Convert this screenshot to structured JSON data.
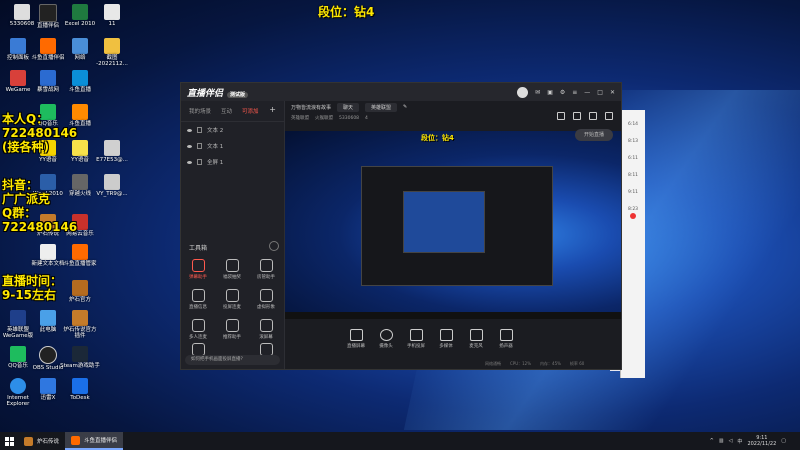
{
  "overlay": {
    "rank_label": "段位：钻4",
    "promo_qq": "本人Q：\n722480146\n(接各种)",
    "promo_douyin": "抖音：\n广广派克\nQ群：\n722480146",
    "promo_time": "直播时间：\n9-15左右"
  },
  "desktop_icons": [
    {
      "name": "user-id",
      "label": "5330608"
    },
    {
      "name": "live-companion",
      "label": "直播伴侣"
    },
    {
      "name": "excel",
      "label": "Excel 2010"
    },
    {
      "name": "folder-11",
      "label": "11"
    },
    {
      "name": "control-panel",
      "label": "控制面板"
    },
    {
      "name": "douyu-live",
      "label": "斗鱼直播伴侣"
    },
    {
      "name": "network",
      "label": "网络"
    },
    {
      "name": "date-folder",
      "label": "截图\n-2022112..."
    },
    {
      "name": "wegame",
      "label": "WeGame"
    },
    {
      "name": "baidu-netdisk",
      "label": "暴雪战网"
    },
    {
      "name": "douyu-app",
      "label": "斗鱼直播"
    },
    {
      "name": "qq-music",
      "label": "QQ音乐"
    },
    {
      "name": "yy-voice",
      "label": "YY语音"
    },
    {
      "name": "zip-file",
      "label": "E77E53@..."
    },
    {
      "name": "word",
      "label": "Word 2010"
    },
    {
      "name": "game-client",
      "label": "穿越火线"
    },
    {
      "name": "vm-file",
      "label": "VY_TR9@..."
    },
    {
      "name": "hearthstone",
      "label": "炉石传说"
    },
    {
      "name": "douyu-helper",
      "label": "斗鱼直播管家"
    },
    {
      "name": "netease-music",
      "label": "网易云音乐"
    },
    {
      "name": "new-txt",
      "label": "新建文本文档"
    },
    {
      "name": "game-box",
      "label": "炉石官方"
    },
    {
      "name": "hs-deck",
      "label": "暗影宇宙"
    },
    {
      "name": "wegame-2",
      "label": "英雄联盟\nWeGame版"
    },
    {
      "name": "this-pc",
      "label": "此电脑"
    },
    {
      "name": "hs-official",
      "label": "炉石传说官方\n插件"
    },
    {
      "name": "qq-music-2",
      "label": "QQ音乐"
    },
    {
      "name": "obs",
      "label": "OBS Studio"
    },
    {
      "name": "steam",
      "label": "Steam游戏助手"
    },
    {
      "name": "ie",
      "label": "Internet\nExplorer"
    },
    {
      "name": "xunlei",
      "label": "迅雷X"
    },
    {
      "name": "todesk",
      "label": "ToDesk"
    }
  ],
  "app": {
    "logo": "直播伴侣",
    "version": "测试版",
    "tabs": [
      "我的场景",
      "互动",
      "可添加"
    ],
    "scenes": [
      "文本 2",
      "文本 1",
      "全屏 1"
    ],
    "toolbox_title": "工具箱",
    "tools": [
      "弹幕助手",
      "福袋抽奖",
      "房管助手",
      "直播信息",
      "投屏连麦",
      "虚拟形象",
      "多人连麦",
      "推荐助手",
      "滚屏幕",
      "抖音宝",
      "",
      "更多"
    ],
    "hint": "如何把手机画面投屏直播?",
    "stream_title": "万物皆流浪有故事",
    "stream_chip_1": "聊天",
    "stream_chip_2": "英雄联盟",
    "stream_category": "英雄联盟",
    "stream_sub": "火猴联盟",
    "stream_rank": "5330608",
    "viewer_count": "4",
    "preview_rank": "段位：钻4",
    "controls": [
      "直播屏幕",
      "摄像头",
      "手机投屏",
      "多媒体",
      "麦克风",
      "扬声器"
    ],
    "start_label": "开始直播",
    "status": [
      "网络通畅",
      "CPU：12%",
      "内存：45%",
      "帧率 60",
      "码率 1500"
    ]
  },
  "side_panel": {
    "items": [
      "6:14",
      "8:13",
      "6:11",
      "8:11",
      "9:11",
      "8:23"
    ],
    "badge_count": "2"
  },
  "taskbar": {
    "tasks": [
      "炉石传说",
      "斗鱼直播伴侣"
    ],
    "time": "9:11",
    "date": "2022/11/22"
  },
  "colors": {
    "accent": "#ff5a4e",
    "overlay_text": "#ffe800"
  }
}
